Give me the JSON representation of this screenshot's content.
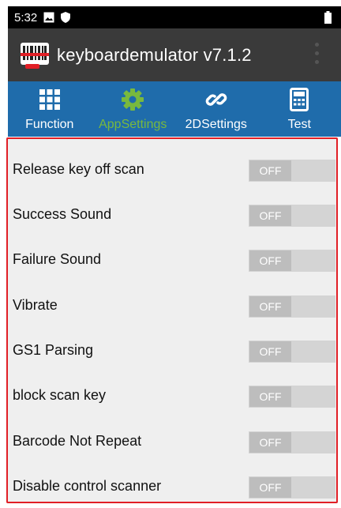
{
  "status_bar": {
    "time": "5:32"
  },
  "app": {
    "title": "keyboardemulator v7.1.2"
  },
  "tabs": [
    {
      "label": "Function",
      "icon": "grid-icon"
    },
    {
      "label": "AppSettings",
      "icon": "gear-icon",
      "active": true
    },
    {
      "label": "2DSettings",
      "icon": "link-icon"
    },
    {
      "label": "Test",
      "icon": "calculator-icon"
    }
  ],
  "settings": [
    {
      "label": "Release key off scan",
      "state": "OFF"
    },
    {
      "label": "Success Sound",
      "state": "OFF"
    },
    {
      "label": "Failure Sound",
      "state": "OFF"
    },
    {
      "label": "Vibrate",
      "state": "OFF"
    },
    {
      "label": "GS1 Parsing",
      "state": "OFF"
    },
    {
      "label": "block scan key",
      "state": "OFF"
    },
    {
      "label": "Barcode Not Repeat",
      "state": "OFF"
    },
    {
      "label": "Disable control scanner",
      "state": "OFF"
    }
  ],
  "colors": {
    "status_bar": "#000000",
    "app_bar": "#3a3a3a",
    "tab_bar": "#1f6cab",
    "active_tab": "#79b93e",
    "highlight_frame": "#e11f26"
  }
}
